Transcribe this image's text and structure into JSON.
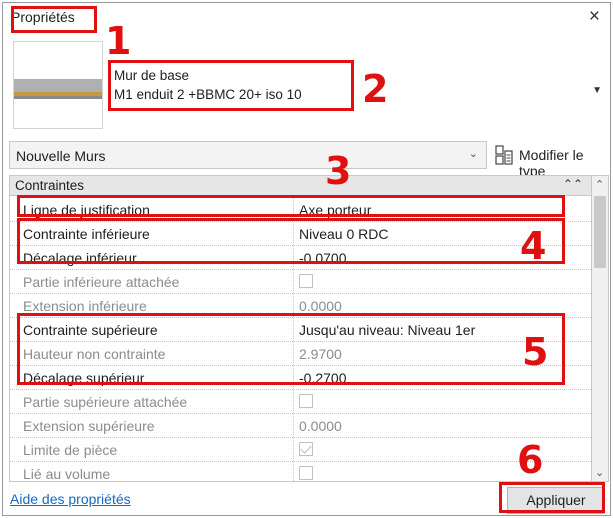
{
  "panel": {
    "title": "Propriétés"
  },
  "type_selector": {
    "family": "Mur de base",
    "type": "M1 enduit 2 +BBMC 20+  iso 10",
    "dropdown_icon": "triangle-down-icon",
    "preview_colors": [
      "#b0b0b0",
      "#c59a3c"
    ]
  },
  "instance_filter": {
    "value": "Nouvelle Murs"
  },
  "edit_type": {
    "label": "Modifier le type",
    "icon": "edit-type-icon"
  },
  "constraints": {
    "group_label": "Contraintes",
    "rows": [
      {
        "name": "Ligne de justification",
        "value": "Axe porteur"
      },
      {
        "name": "Contrainte inférieure",
        "value": "Niveau 0 RDC"
      },
      {
        "name": "Décalage inférieur",
        "value": "-0.0700"
      },
      {
        "name": "Partie inférieure attachée",
        "checked": false
      },
      {
        "name": "Extension inférieure",
        "value": "0.0000"
      },
      {
        "name": "Contrainte supérieure",
        "value": "Jusqu'au niveau: Niveau 1er"
      },
      {
        "name": "Hauteur non contrainte",
        "value": "2.9700"
      },
      {
        "name": "Décalage supérieur",
        "value": "-0.2700"
      },
      {
        "name": "Partie supérieure attachée",
        "checked": false
      },
      {
        "name": "Extension supérieure",
        "value": "0.0000"
      },
      {
        "name": "Limite de pièce",
        "checked": true
      },
      {
        "name": "Lié au volume",
        "checked": false
      }
    ]
  },
  "footer": {
    "help_link": "Aide des propriétés",
    "apply_button": "Appliquer"
  },
  "annotations": {
    "numbers": [
      "1",
      "2",
      "3",
      "4",
      "5",
      "6"
    ],
    "color": "#e01010"
  }
}
